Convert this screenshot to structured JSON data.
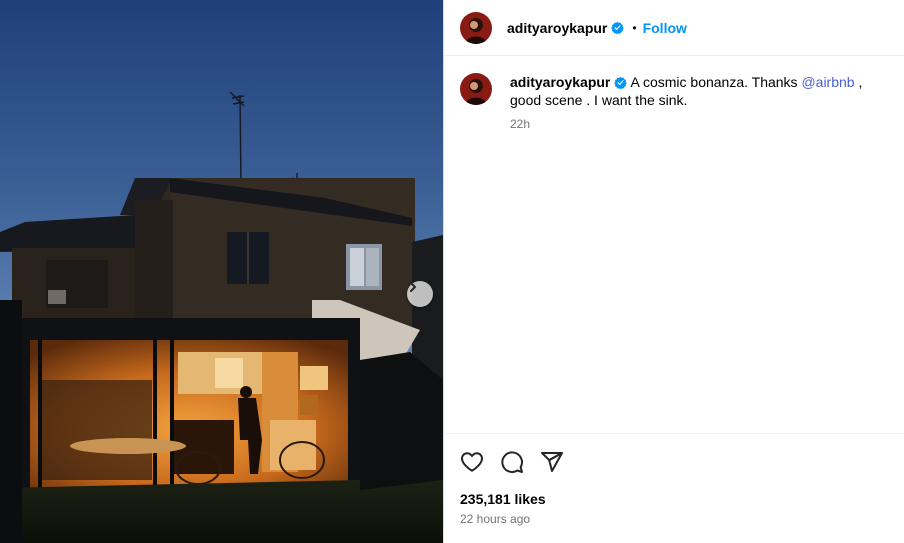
{
  "post": {
    "username": "adityaroykapur",
    "follow_label": "Follow",
    "separator": "•",
    "caption_before": "A cosmic bonanza. Thanks",
    "mention": "@airbnb",
    "caption_after": ", good scene . I want the sink.",
    "comment_age": "22h",
    "likes_text": "235,181 likes",
    "posted_text": "22 hours ago"
  },
  "icons": {
    "verified": "verified-badge-icon",
    "next": "chevron-right-icon",
    "like": "heart-icon",
    "comment": "comment-bubble-icon",
    "share": "paper-plane-icon"
  },
  "colors": {
    "link_blue": "#0095f6",
    "mention": "#4a5fd1",
    "muted_text": "#737373",
    "verified": "#0095f6"
  }
}
